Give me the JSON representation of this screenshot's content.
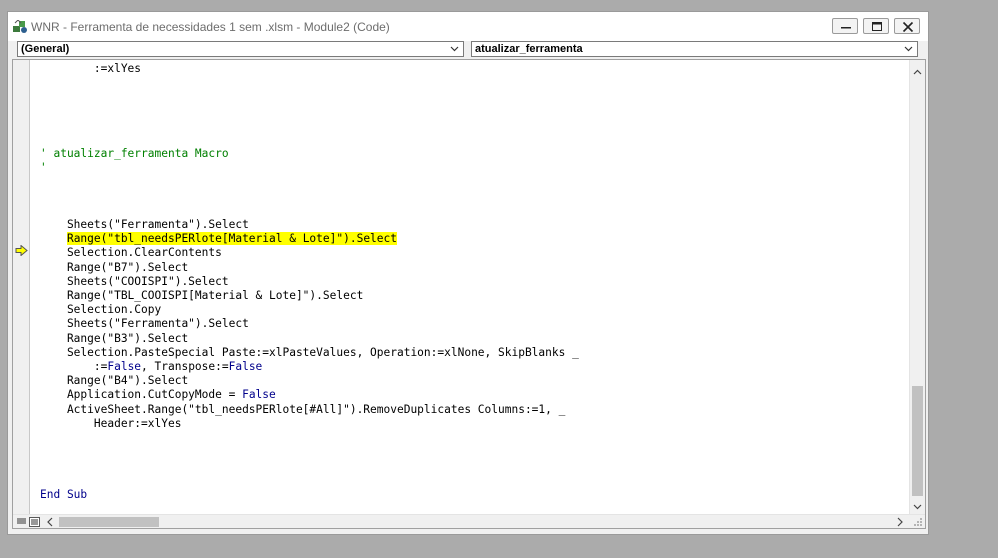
{
  "window": {
    "title": "WNR - Ferramenta de necessidades 1 sem .xlsm - Module2 (Code)"
  },
  "object_dropdown": {
    "value": "(General)"
  },
  "procedure_dropdown": {
    "value": "atualizar_ferramenta"
  },
  "icons": {
    "app": "vba-project-icon",
    "minimize": "minimize-icon",
    "maximize": "maximize-icon",
    "close": "close-icon",
    "dropdown": "chevron-down-icon",
    "execution_pointer": "execution-arrow-icon"
  },
  "colors": {
    "keyword": "#00008b",
    "comment": "#008000",
    "highlight": "#ffff00"
  },
  "code_lines": [
    [
      {
        "t": "        :=xlYes",
        "c": ""
      }
    ],
    [],
    [],
    [],
    [],
    [],
    [
      {
        "t": "' atualizar_ferramenta Macro",
        "c": "cm"
      }
    ],
    [
      {
        "t": "'",
        "c": "cm"
      }
    ],
    [],
    [],
    [],
    [
      {
        "t": "    Sheets(\"Ferramenta\").Select",
        "c": ""
      }
    ],
    [
      {
        "t": "    ",
        "c": ""
      },
      {
        "t": "Range(\"tbl_needsPERlote[Material & Lote]\").Select",
        "c": "hl"
      }
    ],
    [
      {
        "t": "    Selection.ClearContents",
        "c": ""
      }
    ],
    [
      {
        "t": "    Range(\"B7\").Select",
        "c": ""
      }
    ],
    [
      {
        "t": "    Sheets(\"COOISPI\").Select",
        "c": ""
      }
    ],
    [
      {
        "t": "    Range(\"TBL_COOISPI[Material & Lote]\").Select",
        "c": ""
      }
    ],
    [
      {
        "t": "    Selection.Copy",
        "c": ""
      }
    ],
    [
      {
        "t": "    Sheets(\"Ferramenta\").Select",
        "c": ""
      }
    ],
    [
      {
        "t": "    Range(\"B3\").Select",
        "c": ""
      }
    ],
    [
      {
        "t": "    Selection.PasteSpecial Paste:=xlPasteValues, Operation:=xlNone, SkipBlanks _",
        "c": ""
      }
    ],
    [
      {
        "t": "        :=",
        "c": ""
      },
      {
        "t": "False",
        "c": "kw"
      },
      {
        "t": ", Transpose:=",
        "c": ""
      },
      {
        "t": "False",
        "c": "kw"
      }
    ],
    [
      {
        "t": "    Range(\"B4\").Select",
        "c": ""
      }
    ],
    [
      {
        "t": "    Application.CutCopyMode = ",
        "c": ""
      },
      {
        "t": "False",
        "c": "kw"
      }
    ],
    [
      {
        "t": "    ActiveSheet.Range(\"tbl_needsPERlote[#All]\").RemoveDuplicates Columns:=1, _",
        "c": ""
      }
    ],
    [
      {
        "t": "        Header:=xlYes",
        "c": ""
      }
    ],
    [],
    [],
    [],
    [],
    [
      {
        "t": "End Sub",
        "c": "kw"
      }
    ]
  ]
}
